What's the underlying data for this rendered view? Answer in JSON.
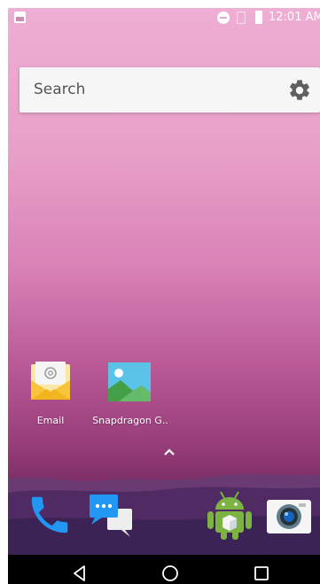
{
  "status_bar": {
    "time": "12:01 AM",
    "icons": [
      "image-notification-icon",
      "do-not-disturb-icon",
      "no-sim-icon",
      "battery-icon"
    ]
  },
  "search": {
    "placeholder": "Search",
    "settings_icon": "gear-icon"
  },
  "home_apps": [
    {
      "label": "Email",
      "icon": "email-icon"
    },
    {
      "label": "Snapdragon G..",
      "icon": "gallery-icon"
    }
  ],
  "app_drawer_handle": "chevron-up-icon",
  "dock": [
    {
      "icon": "phone-icon"
    },
    {
      "icon": "messages-icon"
    },
    {
      "icon": "android-icon"
    },
    {
      "icon": "camera-icon"
    }
  ],
  "navigation": [
    "back-icon",
    "home-icon",
    "recent-apps-icon"
  ],
  "colors": {
    "wallpaper_top": "#efaed3",
    "wallpaper_bottom": "#5e2555",
    "dock_blue": "#2196f3",
    "android_green": "#7cb342",
    "email_yellow": "#f8c43b"
  }
}
